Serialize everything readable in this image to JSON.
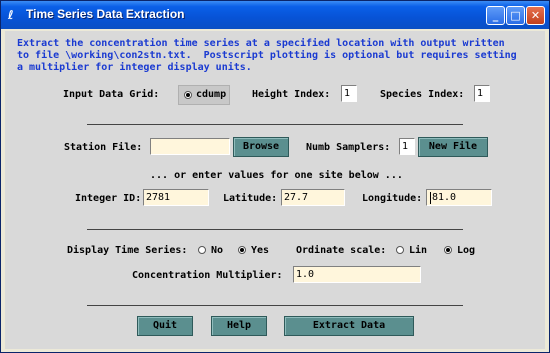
{
  "window": {
    "title": "Time Series Data Extraction",
    "minimize_glyph": "_",
    "maximize_glyph": "□",
    "close_glyph": "✕"
  },
  "description": {
    "line1": "Extract the concentration time series at a specified location with output written",
    "line2": "to file \\working\\con2stn.txt.  Postscript plotting is optional but requires setting",
    "line3": "a multiplier for integer display units."
  },
  "grid": {
    "input_label": "Input Data Grid:",
    "input_option": "cdump",
    "height_label": "Height Index:",
    "height_value": "1",
    "species_label": "Species Index:",
    "species_value": "1"
  },
  "station": {
    "file_label": "Station File:",
    "file_value": "",
    "browse_label": "Browse",
    "samplers_label": "Numb Samplers:",
    "samplers_value": "1",
    "newfile_label": "New File"
  },
  "site": {
    "hint": "... or enter values for one site below ...",
    "id_label": "Integer ID:",
    "id_value": "2781",
    "lat_label": "Latitude:",
    "lat_value": "27.7",
    "lon_label": "Longitude:",
    "lon_value": "81.0"
  },
  "display": {
    "ts_label": "Display Time Series:",
    "no_label": "No",
    "yes_label": "Yes",
    "ts_selected": "Yes",
    "ord_label": "Ordinate scale:",
    "lin_label": "Lin",
    "log_label": "Log",
    "ord_selected": "Log",
    "mult_label": "Concentration Multiplier:",
    "mult_value": "1.0"
  },
  "buttons": {
    "quit": "Quit",
    "help": "Help",
    "extract": "Extract Data"
  },
  "colors": {
    "titlebar": "#0753d6",
    "description_text": "#1a3ad1",
    "button": "#5b8f8f",
    "field": "#fff6dc"
  }
}
